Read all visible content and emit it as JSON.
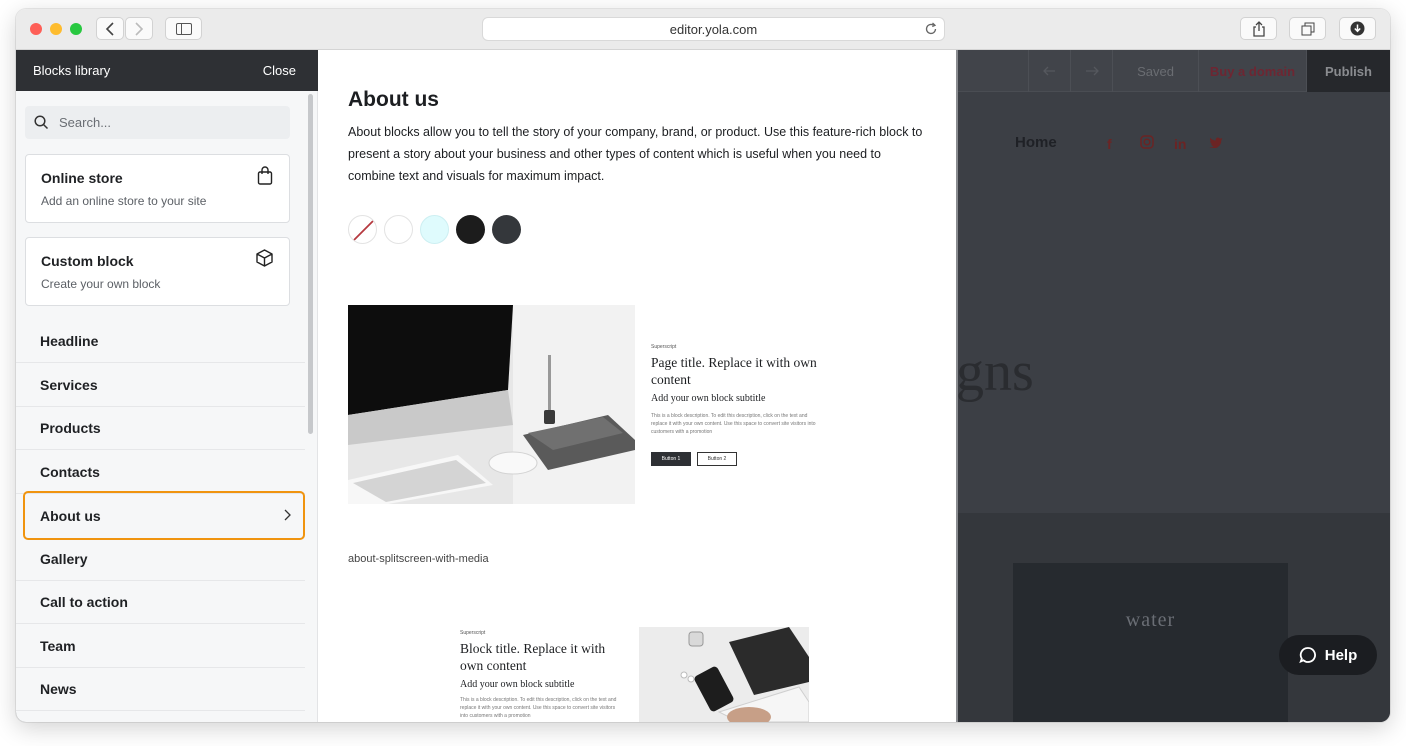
{
  "browser": {
    "url": "editor.yola.com"
  },
  "editor": {
    "toolbar": {
      "saved_label": "Saved",
      "buy_domain_label": "Buy a domain",
      "publish_label": "Publish"
    },
    "nav_home": "Home",
    "big_text": "gns",
    "water_text": "water",
    "help_label": "Help",
    "colors": {
      "accent": "#c0394b",
      "dark": "#2e3034",
      "highlight": "#f0940f"
    }
  },
  "sidebar": {
    "title": "Blocks library",
    "close_label": "Close",
    "search_placeholder": "Search...",
    "cards": [
      {
        "title": "Online store",
        "subtitle": "Add an online store to your site",
        "icon": "shopping-bag-icon"
      },
      {
        "title": "Custom block",
        "subtitle": "Create your own block",
        "icon": "cube-icon"
      }
    ],
    "items": [
      {
        "label": "Headline"
      },
      {
        "label": "Services"
      },
      {
        "label": "Products"
      },
      {
        "label": "Contacts"
      },
      {
        "label": "About us",
        "active": true
      },
      {
        "label": "Gallery"
      },
      {
        "label": "Call to action"
      },
      {
        "label": "Team"
      },
      {
        "label": "News"
      }
    ]
  },
  "panel": {
    "title": "About us",
    "description": "About blocks allow you to tell the story of your company, brand, or product. Use this feature-rich block to present a story about your business and other types of content which is useful when you need to combine text and visuals for maximum impact.",
    "swatches": [
      "none",
      "#ffffff",
      "#dffbfd",
      "#1c1c1c",
      "#34373b"
    ],
    "preview1": {
      "superscript": "Superscript",
      "title": "Page title. Replace it with own content",
      "subtitle": "Add your own block subtitle",
      "body": "This is a block description. To edit this description, click on the text and replace it with your own content. Use this space to convert site visitors into customers with a promotion",
      "button1": "Button 1",
      "button2": "Button 2",
      "label": "about-splitscreen-with-media"
    },
    "preview2": {
      "superscript": "Superscript",
      "title": "Block title. Replace it with own content",
      "subtitle": "Add your own block subtitle",
      "body": "This is a block description. To edit this description, click on the text and replace it with your own content. Use this space to convert site visitors into customers with a promotion"
    }
  }
}
